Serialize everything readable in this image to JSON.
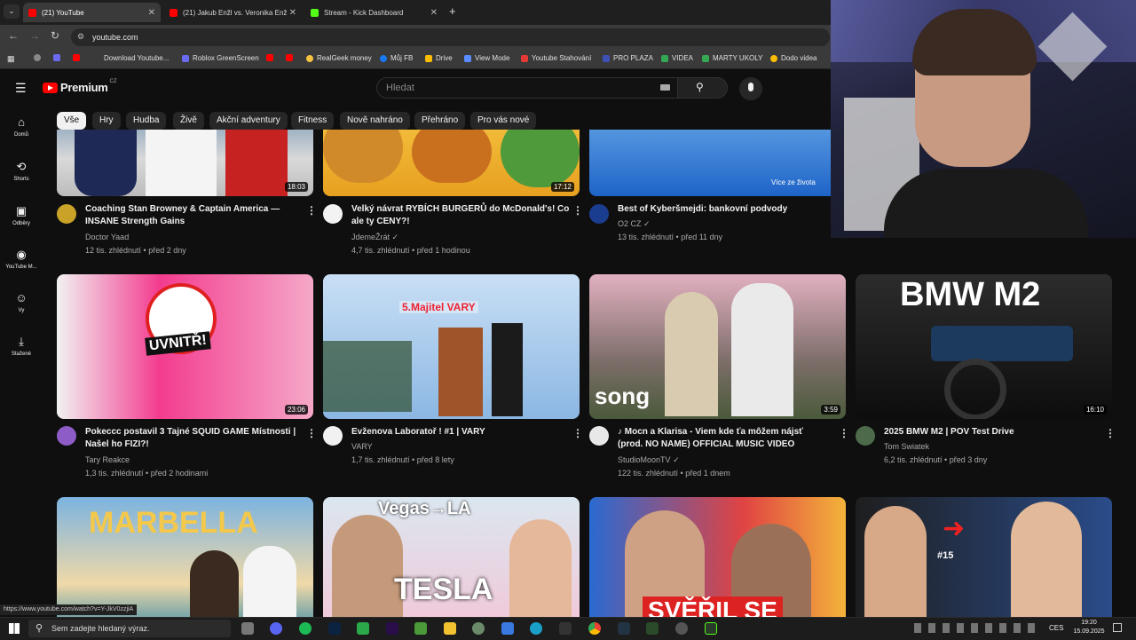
{
  "browser": {
    "tabs": [
      {
        "label": "(21) YouTube",
        "color": "#ff0000"
      },
      {
        "label": "(21) Jakub Enžl vs. Veronika Enž",
        "color": "#ff0000"
      },
      {
        "label": "Stream - Kick Dashboard",
        "color": "#53fc18"
      }
    ],
    "url": "youtube.com",
    "bookmarks": [
      {
        "label": "Download Youtube...",
        "color": "#ff0000"
      },
      {
        "label": "Roblox GreenScreen",
        "color": "#6a6af0"
      },
      {
        "label": "RealGeek money",
        "color": "#f5c242"
      },
      {
        "label": "Můj FB",
        "color": "#1877f2"
      },
      {
        "label": "Drive",
        "color": "#fbbc04"
      },
      {
        "label": "View Mode",
        "color": "#5a8cff"
      },
      {
        "label": "Youtube Stahování",
        "color": "#e53935"
      },
      {
        "label": "PRO PLAZA",
        "color": "#3f51b5"
      },
      {
        "label": "VIDEA",
        "color": "#34a853"
      },
      {
        "label": "MARTY UKOLY",
        "color": "#34a853"
      },
      {
        "label": "Dodo videa",
        "color": "#fbbc04"
      }
    ]
  },
  "header": {
    "logo": "Premium",
    "region": "CZ",
    "search_placeholder": "Hledat"
  },
  "chips": [
    "Vše",
    "Hry",
    "Hudba",
    "Živě",
    "Akční adventury",
    "Fitness",
    "Nově nahráno",
    "Přehráno",
    "Pro vás nové"
  ],
  "sidebar": [
    {
      "label": "Domů",
      "icon": "home-icon"
    },
    {
      "label": "Shorts",
      "icon": "shorts-icon"
    },
    {
      "label": "Odběry",
      "icon": "subscriptions-icon"
    },
    {
      "label": "YouTube M...",
      "icon": "music-icon"
    },
    {
      "label": "Vy",
      "icon": "you-icon"
    },
    {
      "label": "Stažené",
      "icon": "download-icon"
    }
  ],
  "row1": [
    {
      "title1": "Coaching Stan Browney & Captain America —",
      "title2": "INSANE Strength Gains",
      "channel": "Doctor Yaad",
      "meta": "12 tis. zhlédnutí • před 2 dny",
      "duration": "18:03",
      "verified": false
    },
    {
      "title1": "Velký návrat RYBÍCH BURGERŮ do McDonald's! Co",
      "title2": "ale ty CENY?!",
      "channel": "JdemeŽrát",
      "meta": "4,7 tis. zhlédnutí • před 1 hodinou",
      "duration": "17:12",
      "verified": true
    },
    {
      "title1": "Best of Kyberšmejdi: bankovní podvody",
      "title2": "",
      "channel": "O2 CZ",
      "meta": "13 tis. zhlédnutí • před 11 dny",
      "duration": "",
      "verified": true,
      "thumb_text": "Více ze života"
    }
  ],
  "row2": [
    {
      "title1": "Pokeccc postavil 3 Tajné SQUID GAME Místnosti |",
      "title2": "Našel ho FIZI?!",
      "channel": "Tary Reakce",
      "meta": "1,3 tis. zhlédnutí • před 2 hodinami",
      "duration": "23:06",
      "thumb_text": "UVNITŘ!"
    },
    {
      "title1": "Evženova Laboratoř ! #1 | VARY",
      "title2": "",
      "channel": "VARY",
      "meta": "1,7 tis. zhlédnutí • před 8 lety",
      "duration": "",
      "thumb_text": "5.Majitel VARY"
    },
    {
      "title1": "♪ Mocn a Klarisa - Viem kde ťa môžem nájsť",
      "title2": "(prod. NO NAME) OFFICIAL MUSIC VIDEO",
      "channel": "StudioMoonTV",
      "meta": "122 tis. zhlédnutí • před 1 dnem",
      "duration": "3:59",
      "thumb_text": "song"
    },
    {
      "title1": "2025 BMW M2 | POV Test Drive",
      "title2": "",
      "channel": "Tom Swiatek",
      "meta": "6,2 tis. zhlédnutí • před 3 dny",
      "duration": "16:10",
      "thumb_text": "BMW M2"
    }
  ],
  "row3": [
    {
      "thumb_text": "MARBELLA"
    },
    {
      "thumb_text": "Vegas→LA",
      "thumb_text2": "TESLA"
    },
    {
      "thumb_text": "SVĚŘIL SE"
    },
    {
      "thumb_text": "#15"
    }
  ],
  "status_url": "https://www.youtube.com/watch?v=Y-JkV0zzjiA",
  "taskbar": {
    "search_placeholder": "Sem zadejte hledaný výraz.",
    "lang": "CES",
    "time": "19:20",
    "date": "15.09.2025"
  }
}
